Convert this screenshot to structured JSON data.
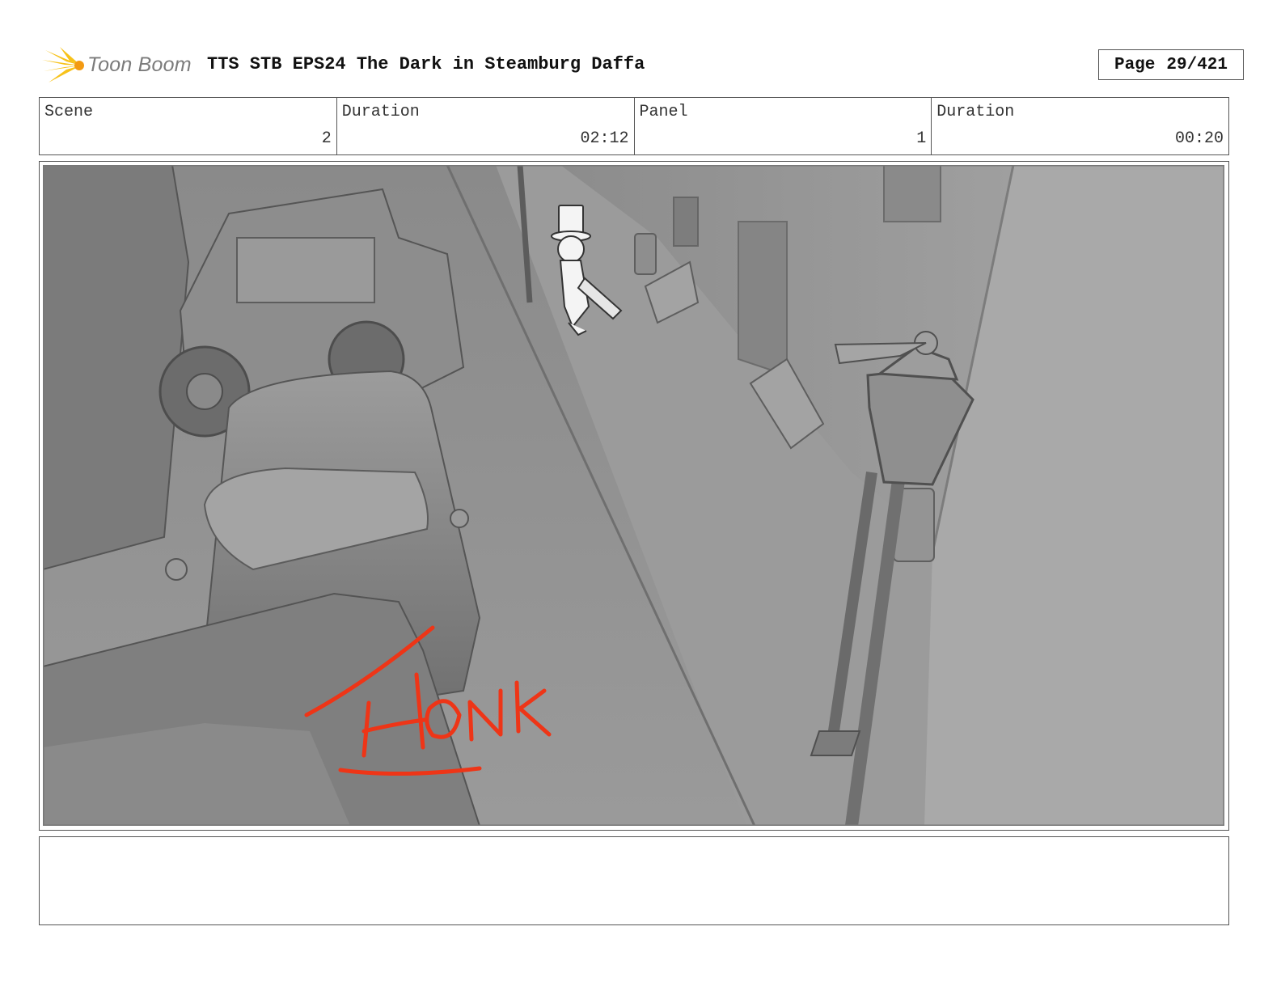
{
  "header": {
    "brand": "Toon Boom",
    "title": "TTS STB EPS24 The Dark in Steamburg Daffa",
    "page_label": "Page",
    "page_value": "29/421"
  },
  "info": {
    "scene_label": "Scene",
    "scene_value": "2",
    "scene_duration_label": "Duration",
    "scene_duration_value": "02:12",
    "panel_label": "Panel",
    "panel_value": "1",
    "panel_duration_label": "Duration",
    "panel_duration_value": "00:20"
  },
  "panel": {
    "sfx_text": "HONK",
    "sfx_color": "#ee3517",
    "scene_tone": "#8f8f8f"
  },
  "notes": {
    "text": ""
  }
}
